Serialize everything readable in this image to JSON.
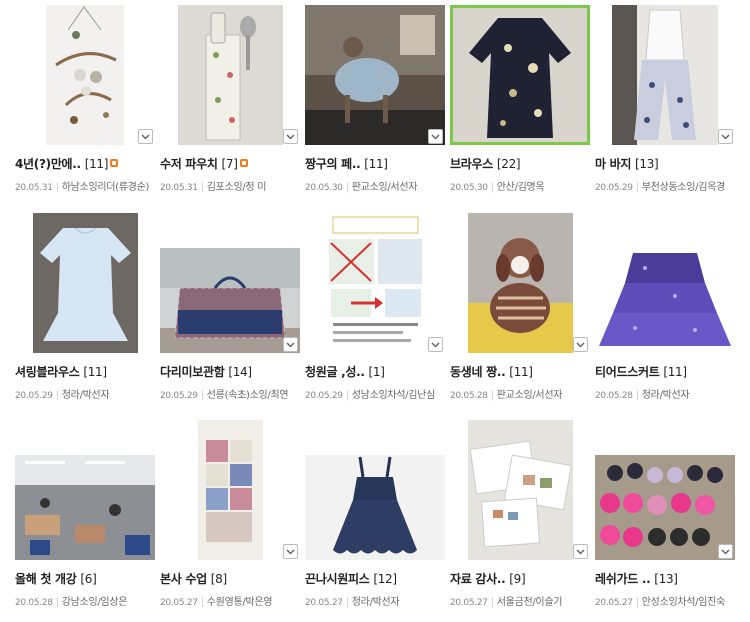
{
  "posts": [
    {
      "title": "4년(?)만에..",
      "count": "[11]",
      "date": "20.05.31",
      "author": "하남소잉리더(류경순)",
      "new_badge": true
    },
    {
      "title": "수저 파우치",
      "count": "[7]",
      "date": "20.05.31",
      "author": "김포소잉/정 미",
      "new_badge": true
    },
    {
      "title": "짱구의 페..",
      "count": "[11]",
      "date": "20.05.30",
      "author": "판교소잉/서선자",
      "new_badge": false
    },
    {
      "title": "브라우스",
      "count": "[22]",
      "date": "20.05.30",
      "author": "안산/김명옥",
      "new_badge": false
    },
    {
      "title": "마 바지",
      "count": "[13]",
      "date": "20.05.29",
      "author": "부천상동소잉/김옥경",
      "new_badge": false
    },
    {
      "title": "셔링블라우스",
      "count": "[11]",
      "date": "20.05.29",
      "author": "청라/박선자",
      "new_badge": false
    },
    {
      "title": "다리미보관함",
      "count": "[14]",
      "date": "20.05.29",
      "author": "선릉(속초)소잉/최연",
      "new_badge": false
    },
    {
      "title": "청원글 ,성..",
      "count": "[1]",
      "date": "20.05.29",
      "author": "성남소잉차석/김난심",
      "new_badge": false
    },
    {
      "title": "동생네 짱..",
      "count": "[11]",
      "date": "20.05.28",
      "author": "판교소잉/서선자",
      "new_badge": false
    },
    {
      "title": "티어드스커트",
      "count": "[11]",
      "date": "20.05.28",
      "author": "청라/박선자",
      "new_badge": false
    },
    {
      "title": "올해 첫 개강",
      "count": "[6]",
      "date": "20.05.28",
      "author": "강남소잉/임상은",
      "new_badge": false
    },
    {
      "title": "본사 수업",
      "count": "[8]",
      "date": "20.05.27",
      "author": "수원영통/박은영",
      "new_badge": false
    },
    {
      "title": "끈나시원피스",
      "count": "[12]",
      "date": "20.05.27",
      "author": "청라/박선자",
      "new_badge": false
    },
    {
      "title": "자료 감사..",
      "count": "[9]",
      "date": "20.05.27",
      "author": "서울금천/이슬기",
      "new_badge": false
    },
    {
      "title": "레쉬가드 ..",
      "count": "[13]",
      "date": "20.05.27",
      "author": "안성소잉차석/임진숙",
      "new_badge": false
    }
  ],
  "icons": {
    "dropdown": "chevron-down-icon",
    "new": "new-badge-icon"
  },
  "colors": {
    "title": "#222222",
    "meta": "#666666",
    "date": "#888888",
    "new_badge": "#ef7e23",
    "selected_border": "#7cc84b"
  }
}
